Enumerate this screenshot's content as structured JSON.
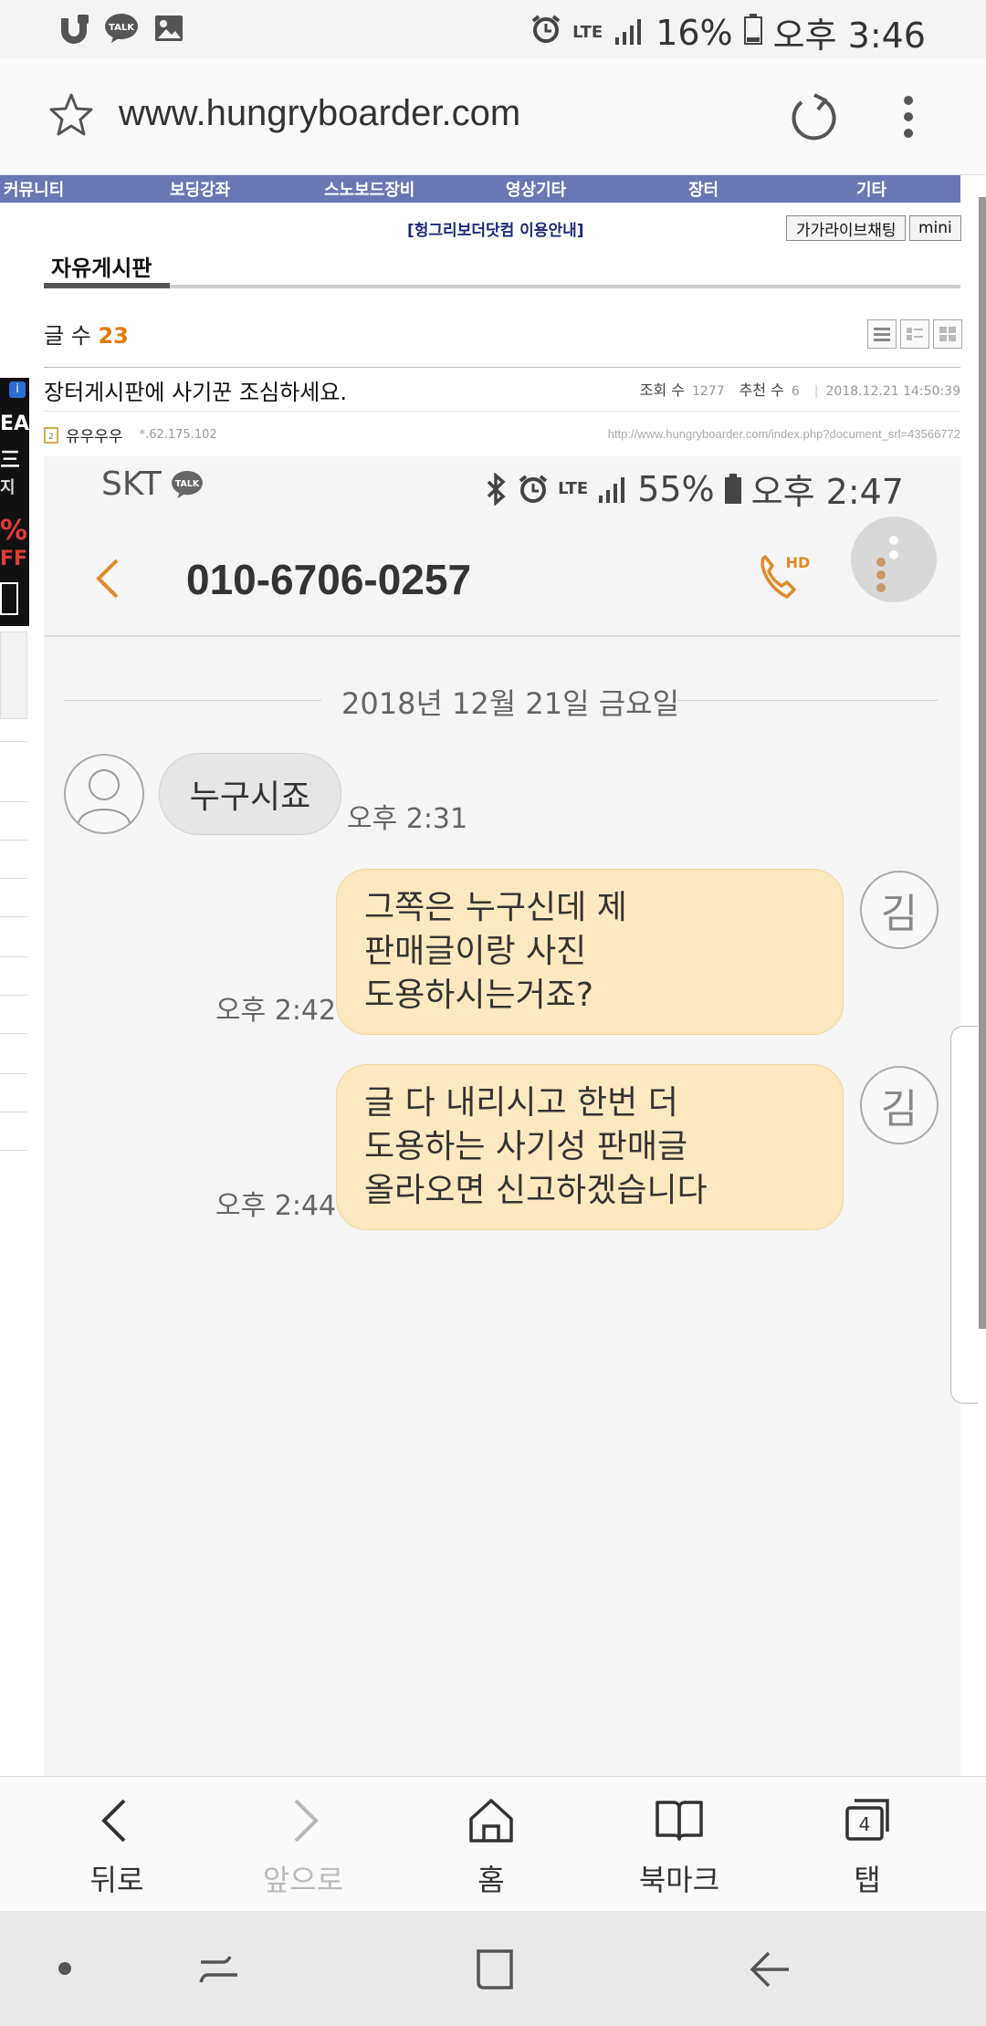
{
  "status_bar": {
    "notification_icons": [
      "u-plus-icon",
      "kakaotalk-icon",
      "gallery-icon"
    ],
    "network": "LTE",
    "battery": "16%",
    "time": "오후 3:46"
  },
  "url_bar": {
    "url": "www.hungryboarder.com"
  },
  "site_nav": {
    "items": [
      "커뮤니티",
      "보딩강좌",
      "스노보드장비",
      "영상기타",
      "장터",
      "기타"
    ]
  },
  "board": {
    "guide_link": "[헝그리보더닷컴 이용안내]",
    "chat_button": "가가라이브채팅",
    "mini_button": "mini",
    "title": "자유게시판",
    "count_label": "글 수",
    "count_value": "23"
  },
  "side_ad": {
    "lines": [
      "EA",
      "三",
      "지",
      "%",
      "FF"
    ]
  },
  "post": {
    "title": "장터게시판에 사기꾼 조심하세요.",
    "views_label": "조회 수",
    "views": "1277",
    "recommend_label": "추천 수",
    "recommend": "6",
    "datetime": "2018.12.21 14:50:39",
    "author": "유우우우",
    "ip": "*.62.175.102",
    "url": "http://www.hungryboarder.com/index.php?document_srl=43566772"
  },
  "embedded_screenshot": {
    "carrier": "SKT",
    "network": "LTE",
    "battery": "55%",
    "time": "오후 2:47",
    "phone_number": "010-6706-0257",
    "call_badge": "HD",
    "date_separator": "2018년 12월 21일 금요일",
    "messages": [
      {
        "direction": "in",
        "lines": [
          "누구시죠"
        ],
        "time": "오후 2:31"
      },
      {
        "direction": "out",
        "avatar": "김",
        "lines": [
          "그쪽은 누구신데 제",
          "판매글이랑 사진",
          "도용하시는거죠?"
        ],
        "time": "오후 2:42"
      },
      {
        "direction": "out",
        "avatar": "김",
        "lines": [
          "글 다 내리시고 한번 더",
          "도용하는 사기성 판매글",
          "올라오면 신고하겠습니다"
        ],
        "time": "오후 2:44"
      }
    ]
  },
  "toolbar": {
    "back": "뒤로",
    "forward": "앞으로",
    "home": "홈",
    "bookmarks": "북마크",
    "tabs": "탭",
    "tab_count": "4"
  },
  "colors": {
    "site_nav_bg": "#6b77b5",
    "count_accent": "#e07a00",
    "outgoing_bubble": "#fde9bf",
    "incoming_bubble": "#e6e6e6",
    "call_icon": "#e08a2a"
  }
}
